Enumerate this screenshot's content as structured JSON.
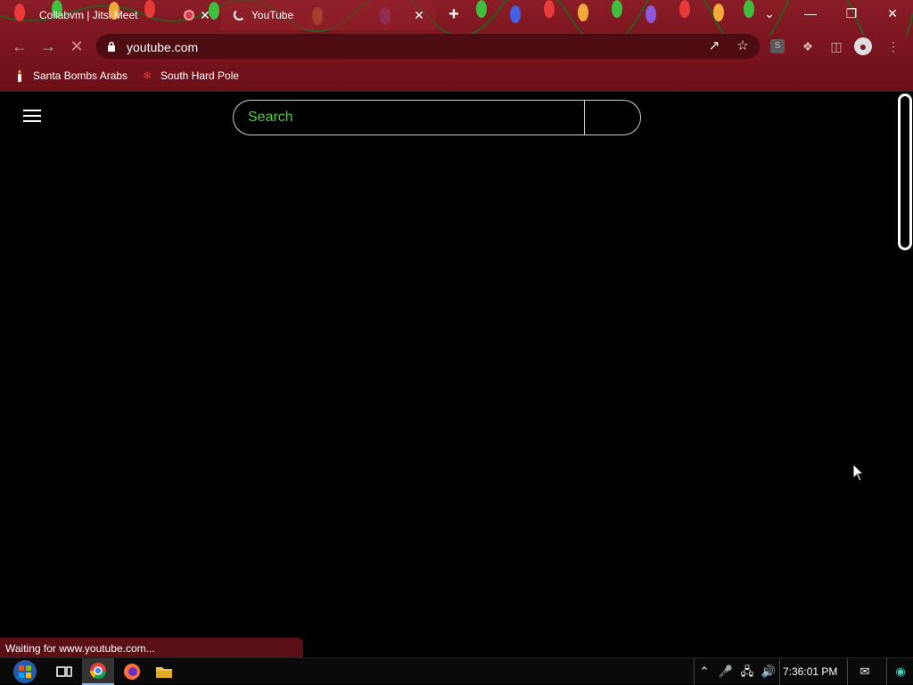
{
  "tabs": [
    {
      "title": "Collabvm | Jitsi Meet",
      "close": "✕"
    },
    {
      "title": "YouTube",
      "close": "✕"
    }
  ],
  "new_tab": "+",
  "window": {
    "dropdown": "⌄",
    "minimize": "—",
    "restore": "❐",
    "close": "✕"
  },
  "address_bar": {
    "url": "youtube.com"
  },
  "toolbar_icons": {
    "profile_badge": "S"
  },
  "bookmarks": [
    {
      "label": "Santa Bombs Arabs",
      "icon": "candle-icon"
    },
    {
      "label": "South Hard Pole",
      "icon": "snowflake-icon"
    }
  ],
  "search": {
    "placeholder": "Search"
  },
  "status_bar": {
    "text": "Waiting for www.youtube.com..."
  },
  "taskbar": {
    "clock": "7:36:01 PM"
  },
  "colors": {
    "accent_green": "#4cd137",
    "chrome_red": "#7c1620",
    "page_bg": "#000000"
  }
}
